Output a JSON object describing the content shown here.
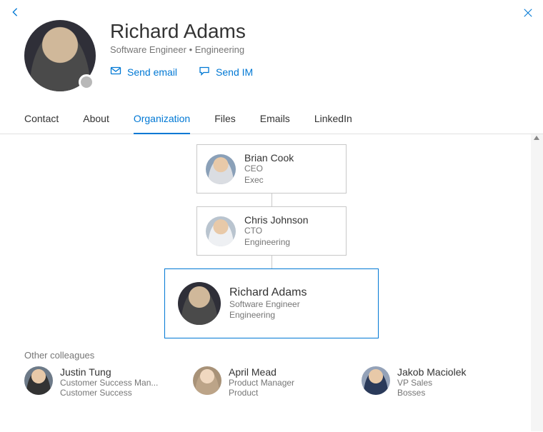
{
  "colors": {
    "accent": "#0078d4"
  },
  "header": {
    "name": "Richard Adams",
    "title": "Software Engineer",
    "department": "Engineering",
    "subtitle_sep": "  •  ",
    "actions": {
      "email": "Send email",
      "im": "Send IM"
    }
  },
  "tabs": [
    {
      "label": "Contact",
      "active": false
    },
    {
      "label": "About",
      "active": false
    },
    {
      "label": "Organization",
      "active": true
    },
    {
      "label": "Files",
      "active": false
    },
    {
      "label": "Emails",
      "active": false
    },
    {
      "label": "LinkedIn",
      "active": false
    }
  ],
  "org": {
    "chain": [
      {
        "name": "Brian Cook",
        "role": "CEO",
        "dept": "Exec"
      },
      {
        "name": "Chris Johnson",
        "role": "CTO",
        "dept": "Engineering"
      }
    ],
    "me": {
      "name": "Richard Adams",
      "role": "Software Engineer",
      "dept": "Engineering"
    }
  },
  "colleagues_label": "Other colleagues",
  "colleagues": [
    {
      "name": "Justin Tung",
      "role": "Customer Success Man...",
      "dept": "Customer Success"
    },
    {
      "name": "April Mead",
      "role": "Product Manager",
      "dept": "Product"
    },
    {
      "name": "Jakob Maciolek",
      "role": "VP Sales",
      "dept": "Bosses"
    }
  ]
}
